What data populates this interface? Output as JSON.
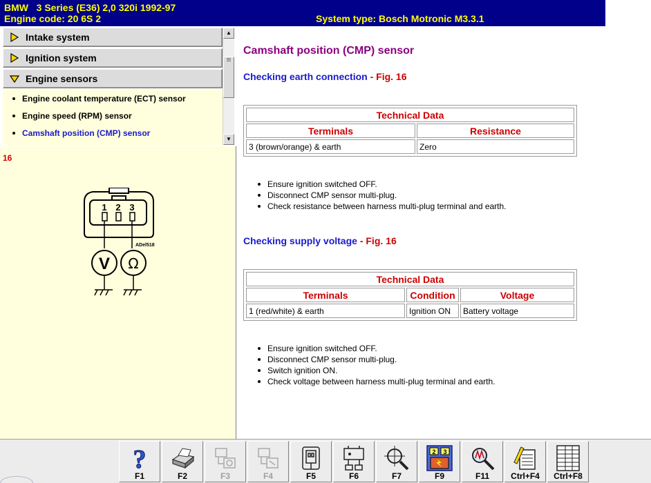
{
  "header": {
    "model_line": "BMW   3 Series (E36) 2,0 320i 1992-97",
    "engine_code": "Engine code: 20 6S 2",
    "system_type": "System type: Bosch Motronic M3.3.1",
    "bg_color": "#00008a",
    "text_color": "#ffff00"
  },
  "nav": {
    "items": [
      {
        "label": "Intake system",
        "icon": "arrow-right-icon"
      },
      {
        "label": "Ignition system",
        "icon": "arrow-right-icon"
      },
      {
        "label": "Engine sensors",
        "icon": "arrow-down-icon",
        "expanded": true
      }
    ],
    "sub_items": [
      {
        "label": "Engine coolant temperature (ECT) sensor"
      },
      {
        "label": "Engine speed (RPM) sensor"
      },
      {
        "label": "Camshaft position (CMP) sensor",
        "active": true
      }
    ]
  },
  "figure": {
    "number": "16",
    "pins": [
      "1",
      "2",
      "3"
    ],
    "label": "ADel518",
    "meters": [
      "V",
      "Ω"
    ]
  },
  "content": {
    "title": "Camshaft position (CMP) sensor",
    "section1": {
      "heading": "Checking earth connection",
      "fig_ref": " - Fig. 16",
      "table": {
        "caption": "Technical Data",
        "headers": [
          "Terminals",
          "Resistance"
        ],
        "rows": [
          [
            "3 (brown/orange) & earth",
            "Zero"
          ]
        ]
      },
      "steps": [
        "Ensure ignition switched OFF.",
        "Disconnect CMP sensor multi-plug.",
        "Check resistance between harness multi-plug terminal and earth."
      ]
    },
    "section2": {
      "heading": "Checking supply voltage",
      "fig_ref": " - Fig. 16",
      "table": {
        "caption": "Technical Data",
        "headers": [
          "Terminals",
          "Condition",
          "Voltage"
        ],
        "rows": [
          [
            "1 (red/white) & earth",
            "Ignition ON",
            "Battery voltage"
          ]
        ]
      },
      "steps": [
        "Ensure ignition switched OFF.",
        "Disconnect CMP sensor multi-plug.",
        "Switch ignition ON.",
        "Check voltage between harness multi-plug terminal and earth."
      ]
    }
  },
  "toolbar": {
    "buttons": [
      {
        "label": "F1",
        "icon": "help-icon",
        "enabled": true
      },
      {
        "label": "F2",
        "icon": "printer-icon",
        "enabled": true
      },
      {
        "label": "F3",
        "icon": "component-icon",
        "enabled": false
      },
      {
        "label": "F4",
        "icon": "component-location-icon",
        "enabled": false
      },
      {
        "label": "F5",
        "icon": "connector-icon",
        "enabled": true
      },
      {
        "label": "F6",
        "icon": "wiring-diagram-icon",
        "enabled": true
      },
      {
        "label": "F7",
        "icon": "magnifier-icon",
        "enabled": true
      },
      {
        "label": "F9",
        "icon": "fault-code-icon",
        "enabled": true
      },
      {
        "label": "F11",
        "icon": "test-probe-icon",
        "enabled": true
      },
      {
        "label": "Ctrl+F4",
        "icon": "notes-icon",
        "enabled": true
      },
      {
        "label": "Ctrl+F8",
        "icon": "table-icon",
        "enabled": true
      }
    ]
  }
}
